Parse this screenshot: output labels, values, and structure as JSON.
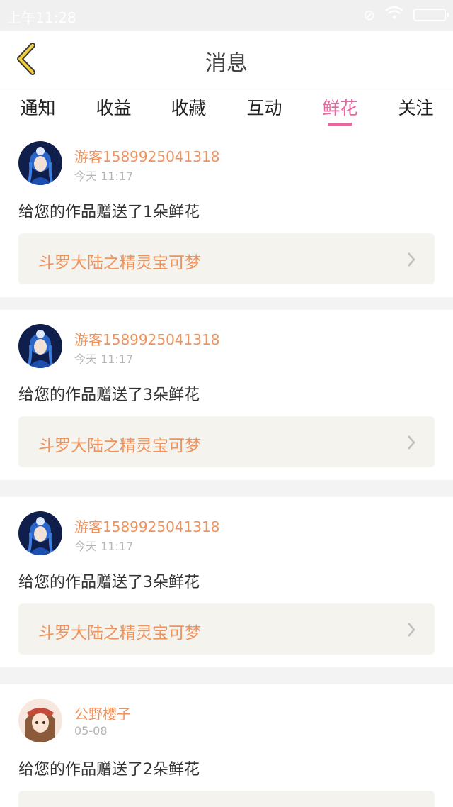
{
  "status_bar": {
    "time": "上午11:28"
  },
  "header": {
    "title": "消息"
  },
  "tabs": [
    {
      "label": "通知"
    },
    {
      "label": "收益"
    },
    {
      "label": "收藏"
    },
    {
      "label": "互动"
    },
    {
      "label": "鲜花"
    },
    {
      "label": "关注"
    }
  ],
  "active_tab": "鲜花",
  "colors": {
    "accent": "#e8659f",
    "name": "#f0925c",
    "card_link_bg": "#f5f3ee"
  },
  "items": [
    {
      "user": "游客1589925041318",
      "time": "今天 11:17",
      "message": "给您的作品赠送了1朵鲜花",
      "work": "斗罗大陆之精灵宝可梦",
      "avatar_icon": "girl-blue-hair-avatar"
    },
    {
      "user": "游客1589925041318",
      "time": "今天 11:17",
      "message": "给您的作品赠送了3朵鲜花",
      "work": "斗罗大陆之精灵宝可梦",
      "avatar_icon": "girl-blue-hair-avatar"
    },
    {
      "user": "游客1589925041318",
      "time": "今天 11:17",
      "message": "给您的作品赠送了3朵鲜花",
      "work": "斗罗大陆之精灵宝可梦",
      "avatar_icon": "girl-blue-hair-avatar"
    },
    {
      "user": "公野樱子",
      "time": "05-08",
      "message": "给您的作品赠送了2朵鲜花",
      "avatar_icon": "girl-brown-hair-avatar"
    }
  ]
}
